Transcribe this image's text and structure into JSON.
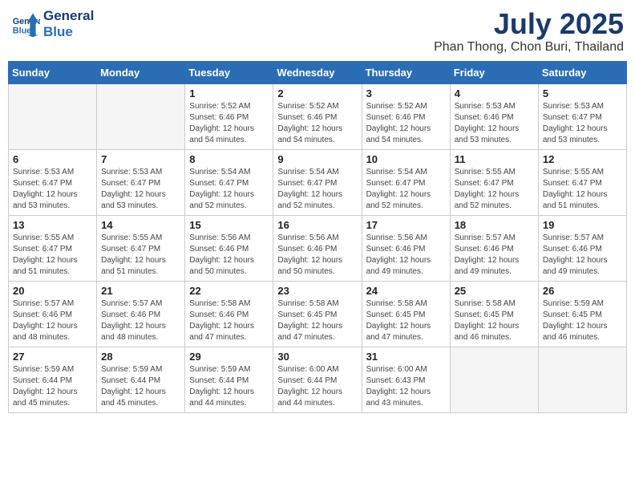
{
  "header": {
    "logo_line1": "General",
    "logo_line2": "Blue",
    "month_year": "July 2025",
    "location": "Phan Thong, Chon Buri, Thailand"
  },
  "days_of_week": [
    "Sunday",
    "Monday",
    "Tuesday",
    "Wednesday",
    "Thursday",
    "Friday",
    "Saturday"
  ],
  "weeks": [
    [
      {
        "day": "",
        "info": ""
      },
      {
        "day": "",
        "info": ""
      },
      {
        "day": "1",
        "info": "Sunrise: 5:52 AM\nSunset: 6:46 PM\nDaylight: 12 hours and 54 minutes."
      },
      {
        "day": "2",
        "info": "Sunrise: 5:52 AM\nSunset: 6:46 PM\nDaylight: 12 hours and 54 minutes."
      },
      {
        "day": "3",
        "info": "Sunrise: 5:52 AM\nSunset: 6:46 PM\nDaylight: 12 hours and 54 minutes."
      },
      {
        "day": "4",
        "info": "Sunrise: 5:53 AM\nSunset: 6:46 PM\nDaylight: 12 hours and 53 minutes."
      },
      {
        "day": "5",
        "info": "Sunrise: 5:53 AM\nSunset: 6:47 PM\nDaylight: 12 hours and 53 minutes."
      }
    ],
    [
      {
        "day": "6",
        "info": "Sunrise: 5:53 AM\nSunset: 6:47 PM\nDaylight: 12 hours and 53 minutes."
      },
      {
        "day": "7",
        "info": "Sunrise: 5:53 AM\nSunset: 6:47 PM\nDaylight: 12 hours and 53 minutes."
      },
      {
        "day": "8",
        "info": "Sunrise: 5:54 AM\nSunset: 6:47 PM\nDaylight: 12 hours and 52 minutes."
      },
      {
        "day": "9",
        "info": "Sunrise: 5:54 AM\nSunset: 6:47 PM\nDaylight: 12 hours and 52 minutes."
      },
      {
        "day": "10",
        "info": "Sunrise: 5:54 AM\nSunset: 6:47 PM\nDaylight: 12 hours and 52 minutes."
      },
      {
        "day": "11",
        "info": "Sunrise: 5:55 AM\nSunset: 6:47 PM\nDaylight: 12 hours and 52 minutes."
      },
      {
        "day": "12",
        "info": "Sunrise: 5:55 AM\nSunset: 6:47 PM\nDaylight: 12 hours and 51 minutes."
      }
    ],
    [
      {
        "day": "13",
        "info": "Sunrise: 5:55 AM\nSunset: 6:47 PM\nDaylight: 12 hours and 51 minutes."
      },
      {
        "day": "14",
        "info": "Sunrise: 5:55 AM\nSunset: 6:47 PM\nDaylight: 12 hours and 51 minutes."
      },
      {
        "day": "15",
        "info": "Sunrise: 5:56 AM\nSunset: 6:46 PM\nDaylight: 12 hours and 50 minutes."
      },
      {
        "day": "16",
        "info": "Sunrise: 5:56 AM\nSunset: 6:46 PM\nDaylight: 12 hours and 50 minutes."
      },
      {
        "day": "17",
        "info": "Sunrise: 5:56 AM\nSunset: 6:46 PM\nDaylight: 12 hours and 49 minutes."
      },
      {
        "day": "18",
        "info": "Sunrise: 5:57 AM\nSunset: 6:46 PM\nDaylight: 12 hours and 49 minutes."
      },
      {
        "day": "19",
        "info": "Sunrise: 5:57 AM\nSunset: 6:46 PM\nDaylight: 12 hours and 49 minutes."
      }
    ],
    [
      {
        "day": "20",
        "info": "Sunrise: 5:57 AM\nSunset: 6:46 PM\nDaylight: 12 hours and 48 minutes."
      },
      {
        "day": "21",
        "info": "Sunrise: 5:57 AM\nSunset: 6:46 PM\nDaylight: 12 hours and 48 minutes."
      },
      {
        "day": "22",
        "info": "Sunrise: 5:58 AM\nSunset: 6:46 PM\nDaylight: 12 hours and 47 minutes."
      },
      {
        "day": "23",
        "info": "Sunrise: 5:58 AM\nSunset: 6:45 PM\nDaylight: 12 hours and 47 minutes."
      },
      {
        "day": "24",
        "info": "Sunrise: 5:58 AM\nSunset: 6:45 PM\nDaylight: 12 hours and 47 minutes."
      },
      {
        "day": "25",
        "info": "Sunrise: 5:58 AM\nSunset: 6:45 PM\nDaylight: 12 hours and 46 minutes."
      },
      {
        "day": "26",
        "info": "Sunrise: 5:59 AM\nSunset: 6:45 PM\nDaylight: 12 hours and 46 minutes."
      }
    ],
    [
      {
        "day": "27",
        "info": "Sunrise: 5:59 AM\nSunset: 6:44 PM\nDaylight: 12 hours and 45 minutes."
      },
      {
        "day": "28",
        "info": "Sunrise: 5:59 AM\nSunset: 6:44 PM\nDaylight: 12 hours and 45 minutes."
      },
      {
        "day": "29",
        "info": "Sunrise: 5:59 AM\nSunset: 6:44 PM\nDaylight: 12 hours and 44 minutes."
      },
      {
        "day": "30",
        "info": "Sunrise: 6:00 AM\nSunset: 6:44 PM\nDaylight: 12 hours and 44 minutes."
      },
      {
        "day": "31",
        "info": "Sunrise: 6:00 AM\nSunset: 6:43 PM\nDaylight: 12 hours and 43 minutes."
      },
      {
        "day": "",
        "info": ""
      },
      {
        "day": "",
        "info": ""
      }
    ]
  ]
}
